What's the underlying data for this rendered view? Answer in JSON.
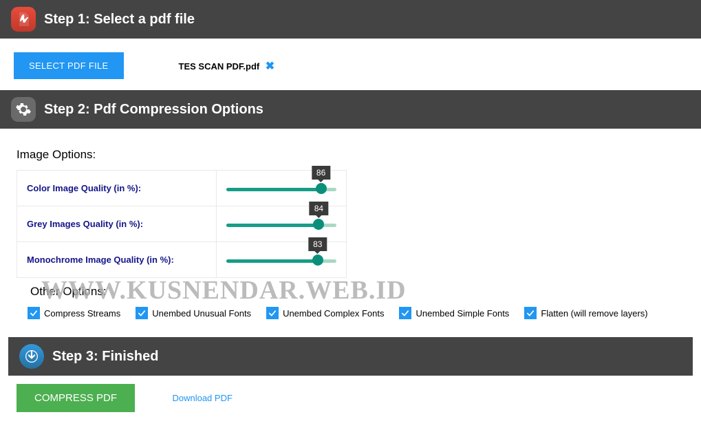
{
  "step1": {
    "title": "Step 1: Select a pdf file",
    "select_btn": "SELECT PDF FILE",
    "filename": "TES SCAN PDF.pdf"
  },
  "step2": {
    "title": "Step 2: Pdf Compression Options",
    "image_options_label": "Image Options:",
    "sliders": [
      {
        "label": "Color Image Quality (in %):",
        "value": 86
      },
      {
        "label": "Grey Images Quality (in %):",
        "value": 84
      },
      {
        "label": "Monochrome Image Quality (in %):",
        "value": 83
      }
    ],
    "other_options_label": "Other Options:",
    "checkboxes": [
      {
        "label": "Compress Streams",
        "checked": true
      },
      {
        "label": "Unembed Unusual Fonts",
        "checked": true
      },
      {
        "label": "Unembed Complex Fonts",
        "checked": true
      },
      {
        "label": "Unembed Simple Fonts",
        "checked": true
      },
      {
        "label": "Flatten (will remove layers)",
        "checked": true
      }
    ]
  },
  "step3": {
    "title": "Step 3: Finished",
    "compress_btn": "COMPRESS PDF",
    "download_link": "Download PDF"
  },
  "watermark": "WWW.KUSNENDAR.WEB.ID"
}
